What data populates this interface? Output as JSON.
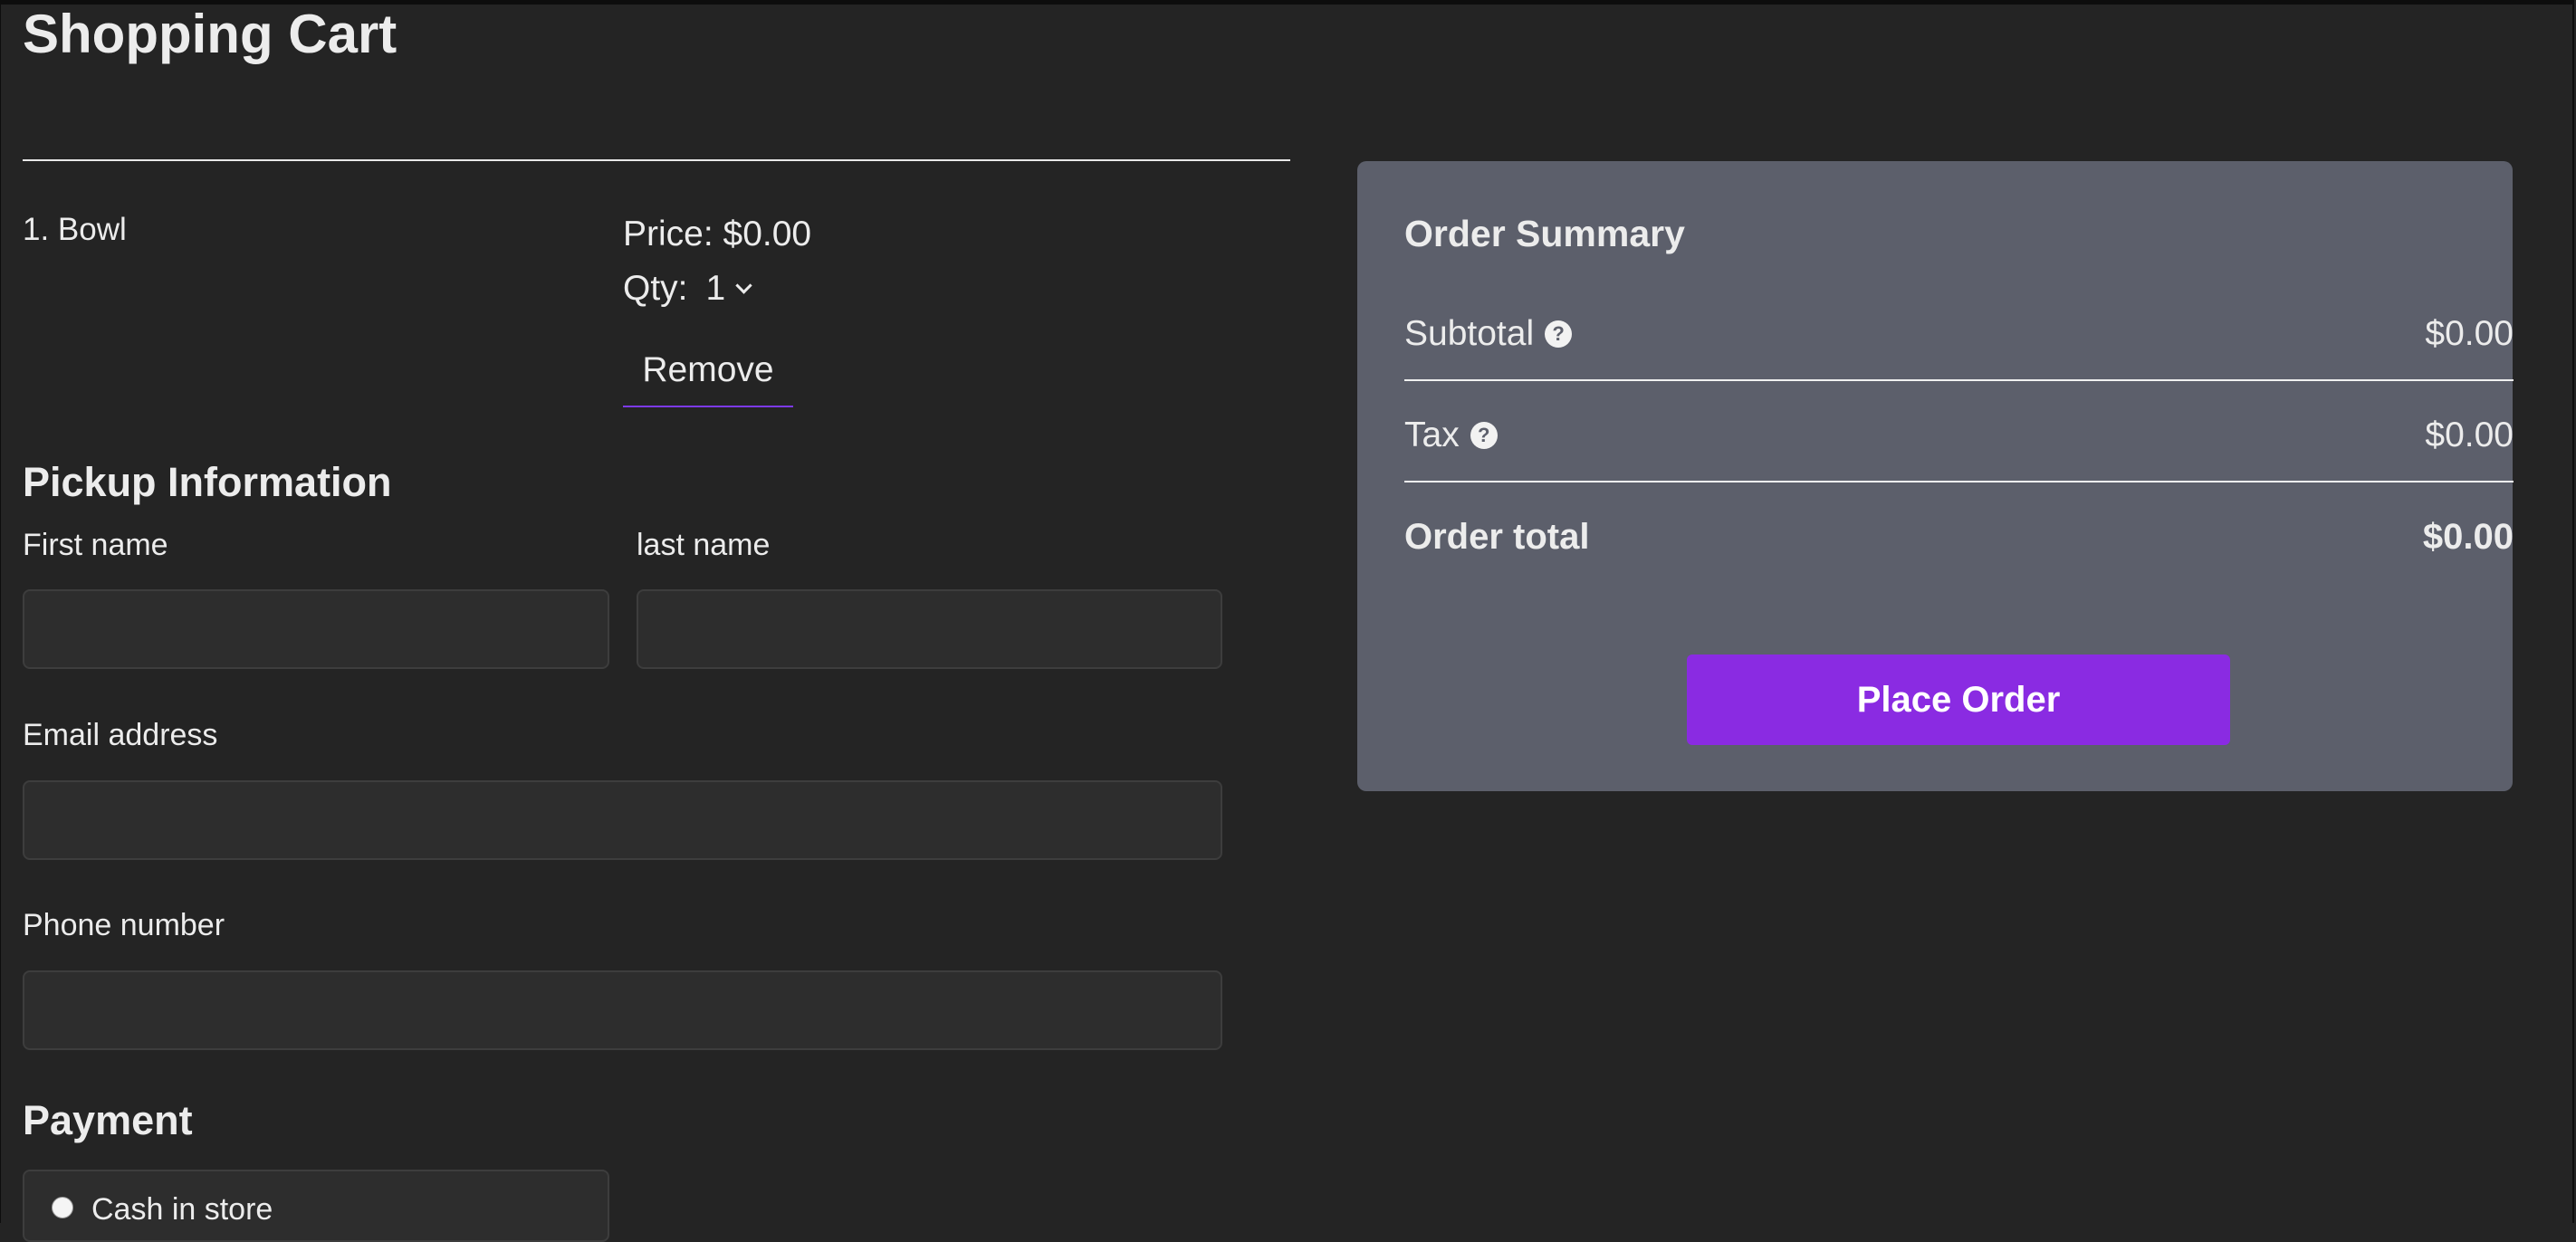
{
  "cart": {
    "title": "Shopping Cart",
    "items": [
      {
        "name": "1. Bowl",
        "price": "Price: $0.00",
        "qty_label": "Qty:",
        "qty_value": "1",
        "remove_label": "Remove"
      }
    ]
  },
  "pickup": {
    "heading": "Pickup Information",
    "first_name_label": "First name",
    "first_name_value": "",
    "last_name_label": "last name",
    "last_name_value": "",
    "email_label": "Email address",
    "email_value": "",
    "phone_label": "Phone number",
    "phone_value": ""
  },
  "payment": {
    "heading": "Payment",
    "options": [
      {
        "label": "Cash in store",
        "selected": false
      }
    ]
  },
  "summary": {
    "title": "Order Summary",
    "subtotal_label": "Subtotal",
    "subtotal_value": "$0.00",
    "tax_label": "Tax",
    "tax_value": "$0.00",
    "total_label": "Order total",
    "total_value": "$0.00",
    "help_glyph": "?",
    "place_order_label": "Place Order"
  },
  "colors": {
    "background": "#242424",
    "summary_card": "#5c5f6b",
    "accent": "#8a2be2",
    "input_background": "#2d2d2d"
  },
  "icons": {
    "qty_dropdown": "chevron-down-icon",
    "help": "question-circle-icon",
    "radio": "radio-button-icon"
  }
}
